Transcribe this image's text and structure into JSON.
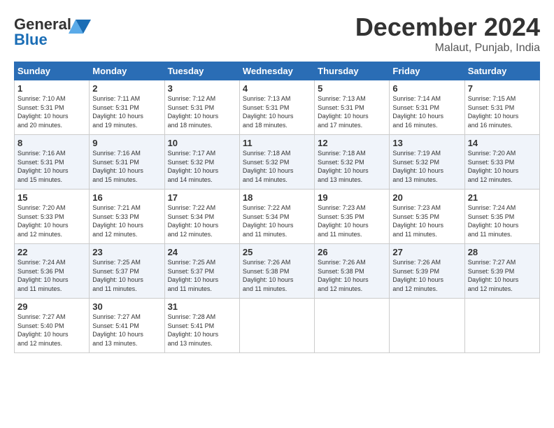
{
  "header": {
    "logo_line1": "General",
    "logo_line2": "Blue",
    "month": "December 2024",
    "location": "Malaut, Punjab, India"
  },
  "days_of_week": [
    "Sunday",
    "Monday",
    "Tuesday",
    "Wednesday",
    "Thursday",
    "Friday",
    "Saturday"
  ],
  "weeks": [
    [
      {
        "day": "1",
        "info": "Sunrise: 7:10 AM\nSunset: 5:31 PM\nDaylight: 10 hours\nand 20 minutes."
      },
      {
        "day": "2",
        "info": "Sunrise: 7:11 AM\nSunset: 5:31 PM\nDaylight: 10 hours\nand 19 minutes."
      },
      {
        "day": "3",
        "info": "Sunrise: 7:12 AM\nSunset: 5:31 PM\nDaylight: 10 hours\nand 18 minutes."
      },
      {
        "day": "4",
        "info": "Sunrise: 7:13 AM\nSunset: 5:31 PM\nDaylight: 10 hours\nand 18 minutes."
      },
      {
        "day": "5",
        "info": "Sunrise: 7:13 AM\nSunset: 5:31 PM\nDaylight: 10 hours\nand 17 minutes."
      },
      {
        "day": "6",
        "info": "Sunrise: 7:14 AM\nSunset: 5:31 PM\nDaylight: 10 hours\nand 16 minutes."
      },
      {
        "day": "7",
        "info": "Sunrise: 7:15 AM\nSunset: 5:31 PM\nDaylight: 10 hours\nand 16 minutes."
      }
    ],
    [
      {
        "day": "8",
        "info": "Sunrise: 7:16 AM\nSunset: 5:31 PM\nDaylight: 10 hours\nand 15 minutes."
      },
      {
        "day": "9",
        "info": "Sunrise: 7:16 AM\nSunset: 5:31 PM\nDaylight: 10 hours\nand 15 minutes."
      },
      {
        "day": "10",
        "info": "Sunrise: 7:17 AM\nSunset: 5:32 PM\nDaylight: 10 hours\nand 14 minutes."
      },
      {
        "day": "11",
        "info": "Sunrise: 7:18 AM\nSunset: 5:32 PM\nDaylight: 10 hours\nand 14 minutes."
      },
      {
        "day": "12",
        "info": "Sunrise: 7:18 AM\nSunset: 5:32 PM\nDaylight: 10 hours\nand 13 minutes."
      },
      {
        "day": "13",
        "info": "Sunrise: 7:19 AM\nSunset: 5:32 PM\nDaylight: 10 hours\nand 13 minutes."
      },
      {
        "day": "14",
        "info": "Sunrise: 7:20 AM\nSunset: 5:33 PM\nDaylight: 10 hours\nand 12 minutes."
      }
    ],
    [
      {
        "day": "15",
        "info": "Sunrise: 7:20 AM\nSunset: 5:33 PM\nDaylight: 10 hours\nand 12 minutes."
      },
      {
        "day": "16",
        "info": "Sunrise: 7:21 AM\nSunset: 5:33 PM\nDaylight: 10 hours\nand 12 minutes."
      },
      {
        "day": "17",
        "info": "Sunrise: 7:22 AM\nSunset: 5:34 PM\nDaylight: 10 hours\nand 12 minutes."
      },
      {
        "day": "18",
        "info": "Sunrise: 7:22 AM\nSunset: 5:34 PM\nDaylight: 10 hours\nand 11 minutes."
      },
      {
        "day": "19",
        "info": "Sunrise: 7:23 AM\nSunset: 5:35 PM\nDaylight: 10 hours\nand 11 minutes."
      },
      {
        "day": "20",
        "info": "Sunrise: 7:23 AM\nSunset: 5:35 PM\nDaylight: 10 hours\nand 11 minutes."
      },
      {
        "day": "21",
        "info": "Sunrise: 7:24 AM\nSunset: 5:35 PM\nDaylight: 10 hours\nand 11 minutes."
      }
    ],
    [
      {
        "day": "22",
        "info": "Sunrise: 7:24 AM\nSunset: 5:36 PM\nDaylight: 10 hours\nand 11 minutes."
      },
      {
        "day": "23",
        "info": "Sunrise: 7:25 AM\nSunset: 5:37 PM\nDaylight: 10 hours\nand 11 minutes."
      },
      {
        "day": "24",
        "info": "Sunrise: 7:25 AM\nSunset: 5:37 PM\nDaylight: 10 hours\nand 11 minutes."
      },
      {
        "day": "25",
        "info": "Sunrise: 7:26 AM\nSunset: 5:38 PM\nDaylight: 10 hours\nand 11 minutes."
      },
      {
        "day": "26",
        "info": "Sunrise: 7:26 AM\nSunset: 5:38 PM\nDaylight: 10 hours\nand 12 minutes."
      },
      {
        "day": "27",
        "info": "Sunrise: 7:26 AM\nSunset: 5:39 PM\nDaylight: 10 hours\nand 12 minutes."
      },
      {
        "day": "28",
        "info": "Sunrise: 7:27 AM\nSunset: 5:39 PM\nDaylight: 10 hours\nand 12 minutes."
      }
    ],
    [
      {
        "day": "29",
        "info": "Sunrise: 7:27 AM\nSunset: 5:40 PM\nDaylight: 10 hours\nand 12 minutes."
      },
      {
        "day": "30",
        "info": "Sunrise: 7:27 AM\nSunset: 5:41 PM\nDaylight: 10 hours\nand 13 minutes."
      },
      {
        "day": "31",
        "info": "Sunrise: 7:28 AM\nSunset: 5:41 PM\nDaylight: 10 hours\nand 13 minutes."
      },
      {
        "day": "",
        "info": ""
      },
      {
        "day": "",
        "info": ""
      },
      {
        "day": "",
        "info": ""
      },
      {
        "day": "",
        "info": ""
      }
    ]
  ]
}
